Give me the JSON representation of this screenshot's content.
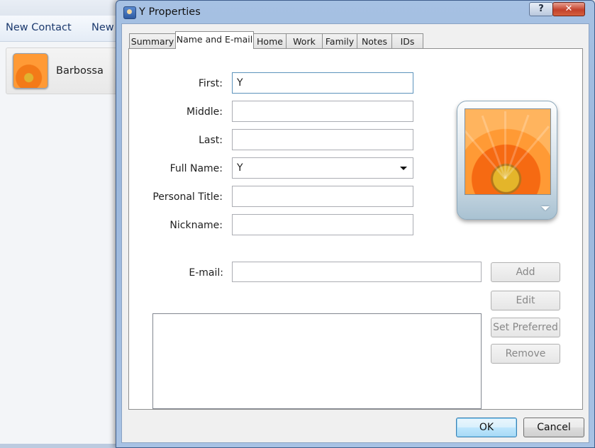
{
  "background_window": {
    "toolbar": [
      "New Contact",
      "New"
    ],
    "contact_name": "Barbossa"
  },
  "dialog": {
    "title": "Y Properties",
    "help_glyph": "?",
    "close_glyph": "✕",
    "tabs": [
      {
        "label": "Summary",
        "active": false
      },
      {
        "label": "Name and E-mail",
        "active": true
      },
      {
        "label": "Home",
        "active": false
      },
      {
        "label": "Work",
        "active": false
      },
      {
        "label": "Family",
        "active": false
      },
      {
        "label": "Notes",
        "active": false
      },
      {
        "label": "IDs",
        "active": false
      }
    ],
    "fields": {
      "first": {
        "label": "First:",
        "value": "Y"
      },
      "middle": {
        "label": "Middle:",
        "value": ""
      },
      "last": {
        "label": "Last:",
        "value": ""
      },
      "full_name": {
        "label": "Full Name:",
        "value": "Y"
      },
      "personal_title": {
        "label": "Personal Title:",
        "value": ""
      },
      "nickname": {
        "label": "Nickname:",
        "value": ""
      },
      "email": {
        "label": "E-mail:",
        "value": ""
      }
    },
    "email_buttons": {
      "add": "Add",
      "edit": "Edit",
      "set_preferred": "Set Preferred",
      "remove": "Remove"
    },
    "footer": {
      "ok": "OK",
      "cancel": "Cancel"
    }
  }
}
